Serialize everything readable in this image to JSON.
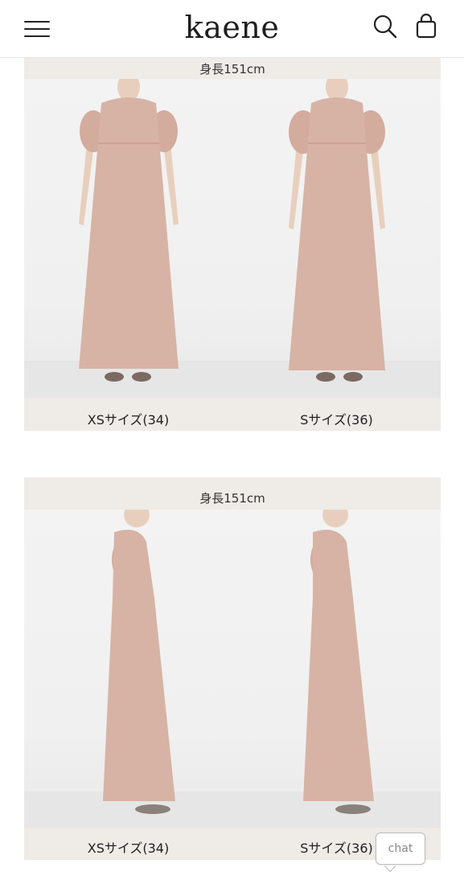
{
  "header": {
    "logo": "kaene",
    "menu_icon": "hamburger-icon",
    "search_icon": "search-icon",
    "bag_icon": "shopping-bag-icon"
  },
  "sections": [
    {
      "title": "身長151cm",
      "view": "front",
      "items": [
        {
          "caption": "XSサイズ(34)"
        },
        {
          "caption": "Sサイズ(36)"
        }
      ]
    },
    {
      "title": "身長151cm",
      "view": "side",
      "items": [
        {
          "caption": "XSサイズ(34)"
        },
        {
          "caption": "Sサイズ(36)"
        }
      ]
    }
  ],
  "chat": {
    "label": "chat"
  },
  "colors": {
    "dress": "#d7b3a5",
    "section_bg": "#efebe7"
  }
}
